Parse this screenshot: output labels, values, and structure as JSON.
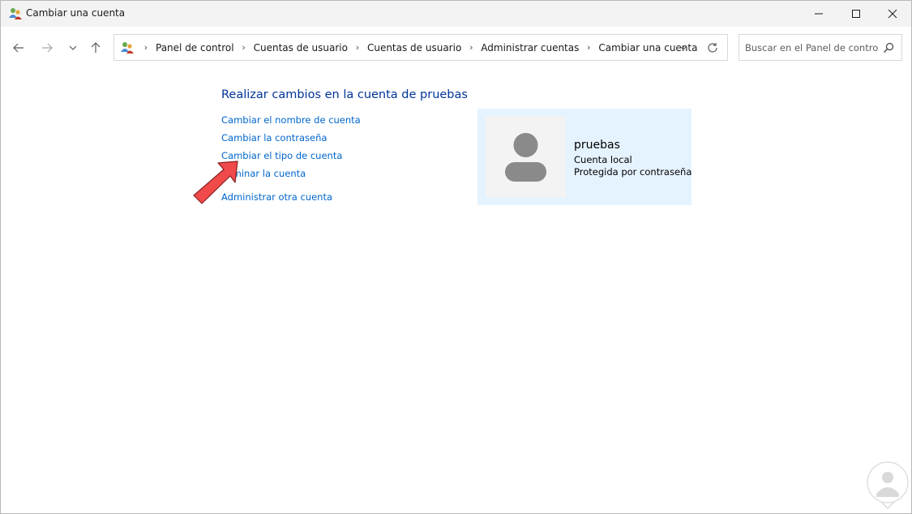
{
  "window": {
    "title": "Cambiar una cuenta"
  },
  "address_bar": {
    "breadcrumbs": [
      "Panel de control",
      "Cuentas de usuario",
      "Cuentas de usuario",
      "Administrar cuentas",
      "Cambiar una cuenta"
    ]
  },
  "search": {
    "placeholder": "Buscar en el Panel de control"
  },
  "main": {
    "heading": "Realizar cambios en la cuenta de pruebas",
    "links": [
      "Cambiar el nombre de cuenta",
      "Cambiar la contraseña",
      "Cambiar el tipo de cuenta",
      "Eliminar la cuenta",
      "Administrar otra cuenta"
    ]
  },
  "account": {
    "name": "pruebas",
    "type": "Cuenta local",
    "protection": "Protegida por contraseña"
  },
  "colors": {
    "link": "#0066cc",
    "heading": "#003399",
    "card_bg": "#e5f3ff",
    "arrow": "#f04a4a"
  },
  "icons": {
    "title": "users-icon",
    "back": "arrow-left-icon",
    "forward": "arrow-right-icon",
    "recent": "chevron-down-icon",
    "up": "arrow-up-icon",
    "search": "search-icon",
    "refresh": "refresh-icon"
  }
}
